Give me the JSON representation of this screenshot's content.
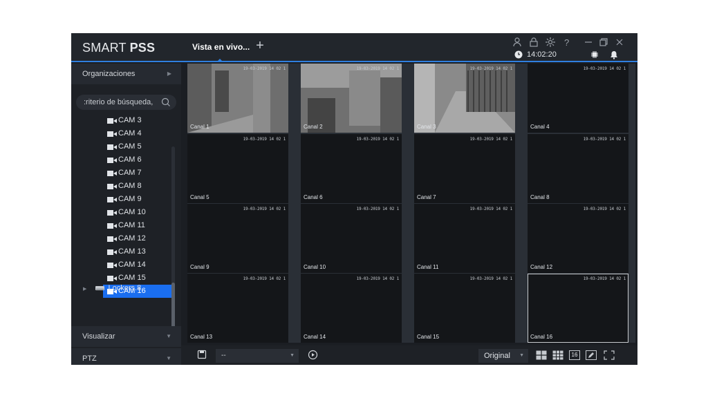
{
  "app": {
    "brand_light": "SMART ",
    "brand_bold": "PSS",
    "tab_live": "Vista en vivo...",
    "tab_add": "+",
    "clock": "14:02:20",
    "accent": "#2f7fe0"
  },
  "sidebar": {
    "organizations": "Organizaciones",
    "search_placeholder": "criterio de búsqueda,",
    "search_shown": ":riterio de búsqueda,",
    "cameras": [
      "CAM 3",
      "CAM 4",
      "CAM 5",
      "CAM 6",
      "CAM 7",
      "CAM 8",
      "CAM 9",
      "CAM 10",
      "CAM 11",
      "CAM 12",
      "CAM 13",
      "CAM 14",
      "CAM 15",
      "CAM 16"
    ],
    "selected_camera": "CAM 16",
    "group": "Lockers.8",
    "visualize": "Visualizar",
    "ptz": "PTZ"
  },
  "grid": {
    "timestamp": "19-03-2019 14 02 1",
    "channels": [
      "Canal 1",
      "Canal 2",
      "Canal 3",
      "Canal 4",
      "Canal 5",
      "Canal 6",
      "Canal 7",
      "Canal 8",
      "Canal 9",
      "Canal 10",
      "Canal 11",
      "Canal 12",
      "Canal 13",
      "Canal 14",
      "Canal 15",
      "Canal 16"
    ],
    "selected_channel": "Canal 16"
  },
  "toolbar": {
    "preset_value": "--",
    "ratio_value": "Original",
    "layout_count": "16"
  }
}
